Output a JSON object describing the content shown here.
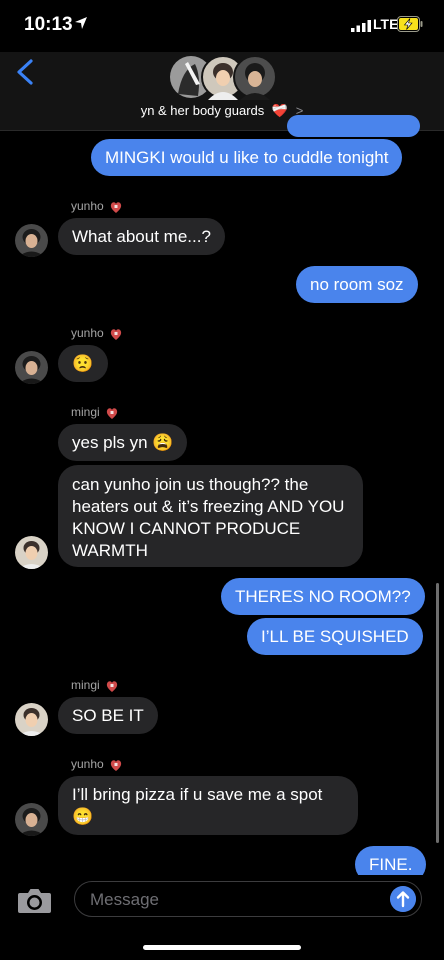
{
  "status": {
    "time": "10:13",
    "network": "LTE"
  },
  "header": {
    "group_title": "yn & her body guards",
    "title_emoji": "❤️‍🩹",
    "chevron": ">"
  },
  "messages": [
    {
      "type": "out",
      "text": "MINGKI would u like to cuddle tonight"
    },
    {
      "sender": "yunho",
      "text": "What about me...?"
    },
    {
      "type": "out",
      "text": "no room soz"
    },
    {
      "sender": "yunho",
      "text": "😟"
    },
    {
      "sender": "mingi",
      "text": "yes pls yn 😩"
    },
    {
      "text": "can yunho join us though?? the heaters out & it’s freezing AND YOU KNOW I CANNOT PRODUCE WARMTH"
    },
    {
      "type": "out",
      "text": "THERES NO ROOM??"
    },
    {
      "type": "out",
      "text": "I’LL BE SQUISHED"
    },
    {
      "sender": "mingi",
      "text": "SO BE IT"
    },
    {
      "sender": "yunho",
      "text": "I’ll bring pizza if u save me a spot 😁"
    },
    {
      "type": "out",
      "text": "FINE."
    }
  ],
  "composer": {
    "placeholder": "Message"
  },
  "colors": {
    "outgoing": "#4a84ec",
    "incoming": "#262628",
    "background": "#000000"
  },
  "icons": [
    "location-arrow-icon",
    "signal-icon",
    "battery-charging-icon",
    "back-chevron-icon",
    "camera-icon",
    "send-arrow-icon",
    "bleeding-heart-icon"
  ]
}
